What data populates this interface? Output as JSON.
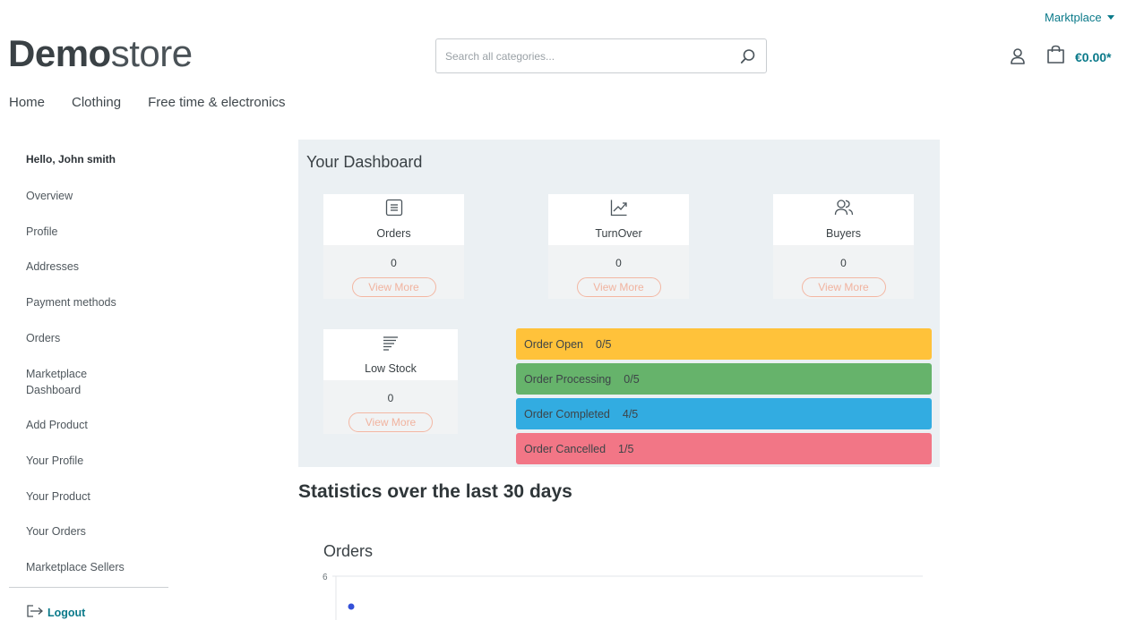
{
  "header": {
    "marketplace_label": "Marktplace",
    "logo_bold": "Demo",
    "logo_regular": "store",
    "search_placeholder": "Search all categories...",
    "cart_total": "€0.00*"
  },
  "nav": {
    "items": [
      "Home",
      "Clothing",
      "Free time & electronics"
    ]
  },
  "sidebar": {
    "greeting": "Hello, John smith",
    "items": [
      "Overview",
      "Profile",
      "Addresses",
      "Payment methods",
      "Orders",
      "Marketplace Dashboard",
      "Add Product",
      "Your Profile",
      "Your Product",
      "Your Orders",
      "Marketplace Sellers"
    ],
    "logout": "Logout"
  },
  "dashboard": {
    "title": "Your Dashboard",
    "view_more": "View More",
    "cards": [
      {
        "label": "Orders",
        "value": "0",
        "icon": "list-icon"
      },
      {
        "label": "TurnOver",
        "value": "0",
        "icon": "trend-up-icon"
      },
      {
        "label": "Buyers",
        "value": "0",
        "icon": "users-icon"
      },
      {
        "label": "Low Stock",
        "value": "0",
        "icon": "stock-lines-icon"
      }
    ],
    "status": [
      {
        "label": "Order Open",
        "count": "0/5",
        "color": "#ffc23a"
      },
      {
        "label": "Order Processing",
        "count": "0/5",
        "color": "#66b36b"
      },
      {
        "label": "Order Completed",
        "count": "4/5",
        "color": "#32ace1"
      },
      {
        "label": "Order Cancelled",
        "count": "1/5",
        "color": "#f27686"
      }
    ]
  },
  "stats": {
    "title": "Statistics over the last 30 days",
    "chart_title": "Orders"
  },
  "chart_data": {
    "type": "scatter",
    "title": "Orders",
    "y_ticks": [
      "6"
    ],
    "ylim": [
      0,
      6
    ],
    "points_visible": 1,
    "series_color": "#3450d8"
  }
}
